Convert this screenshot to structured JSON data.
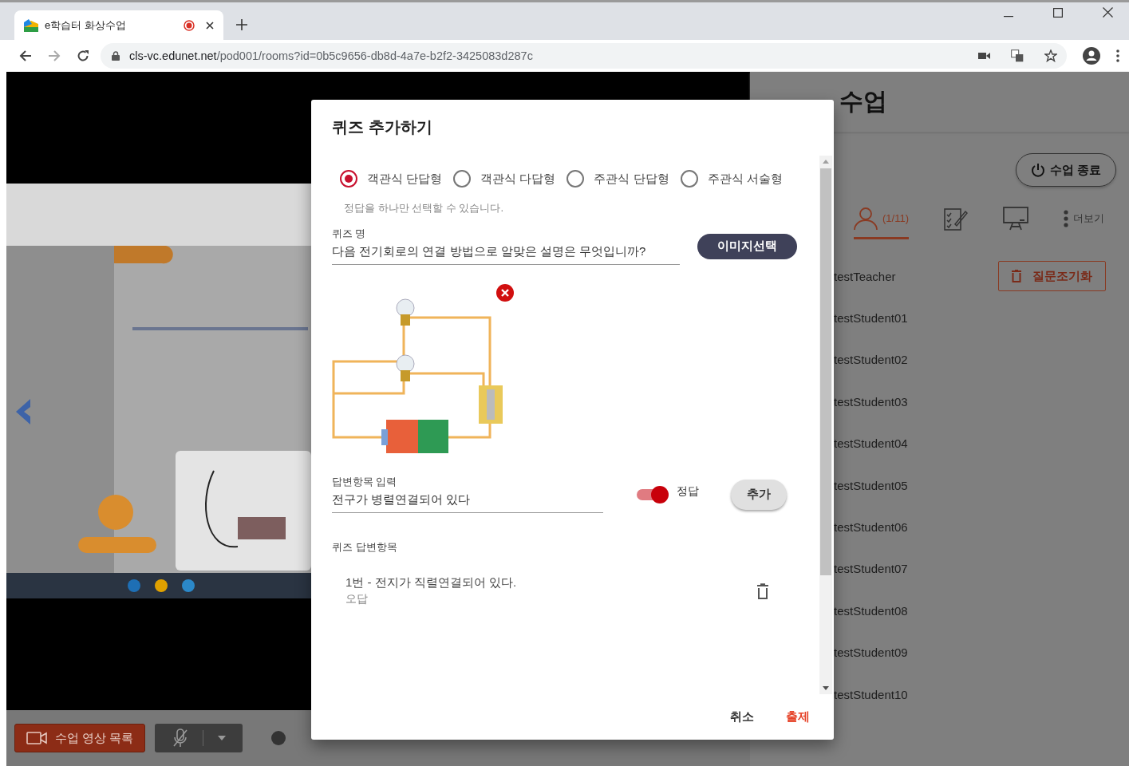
{
  "browser": {
    "tab": {
      "title": "e학습터 화상수업",
      "recording": true
    },
    "url": {
      "host": "cls-vc.edunet.net",
      "path": "/pod001/rooms?id=0b5c9656-db8d-4a7e-b2f2-3425083d287c"
    }
  },
  "video_panel": {
    "kind": "picture",
    "video_list_button": "수업 영상 목록"
  },
  "right_panel": {
    "title": "수업",
    "end_button": "수업 종료",
    "tabs": [
      {
        "kind": "participants",
        "label": "(1/11)",
        "selected": true
      },
      {
        "kind": "quiz",
        "selected": false
      },
      {
        "kind": "board",
        "selected": false
      },
      {
        "kind": "more",
        "label": "더보기",
        "selected": false
      }
    ],
    "reset_button": "질문조기화",
    "participants": [
      "testTeacher",
      "testStudent01",
      "testStudent02",
      "testStudent03",
      "testStudent04",
      "testStudent05",
      "testStudent06",
      "testStudent07",
      "testStudent08",
      "testStudent09",
      "testStudent10"
    ]
  },
  "dialog": {
    "title": "퀴즈 추가하기",
    "question_types": [
      {
        "label": "객관식 단답형",
        "selected": true
      },
      {
        "label": "객관식 다답형",
        "selected": false
      },
      {
        "label": "주관식 단답형",
        "selected": false
      },
      {
        "label": "주관식 서술형",
        "selected": false
      }
    ],
    "hint": "정답을 하나만 선택할 수 있습니다.",
    "quiz_name": {
      "label": "퀴즈 명",
      "value": "다음 전기회로의 연결 방법으로 알맞은 설명은 무엇입니까?"
    },
    "image_button": "이미지선택",
    "answer_input": {
      "label": "답변항목 입력",
      "value": "전구가 병렬연결되어 있다"
    },
    "correct_toggle": {
      "label": "정답",
      "on": true
    },
    "add_button": "추가",
    "answers_label": "퀴즈 답변항목",
    "answers": [
      {
        "text": "1번 - 전지가 직렬연결되어 있다.",
        "status": "오답"
      }
    ],
    "cancel_button": "취소",
    "submit_button": "출제"
  }
}
